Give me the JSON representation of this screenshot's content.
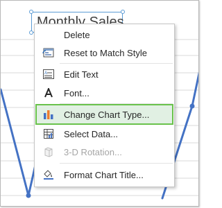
{
  "chart": {
    "title": "Monthly Sales",
    "line_color": "#4472c4"
  },
  "context_menu": {
    "items": [
      {
        "name": "delete",
        "icon": "delete-icon",
        "label": "Delete",
        "enabled": true
      },
      {
        "name": "reset-to-match-style",
        "icon": "reset-style-icon",
        "label": "Reset to Match Style",
        "enabled": true
      },
      {
        "name": "edit-text",
        "icon": "edit-text-icon",
        "label": "Edit Text",
        "enabled": true
      },
      {
        "name": "font",
        "icon": "font-icon",
        "label": "Font...",
        "enabled": true
      },
      {
        "name": "change-chart-type",
        "icon": "chart-type-icon",
        "label": "Change Chart Type...",
        "enabled": true,
        "highlighted": true
      },
      {
        "name": "select-data",
        "icon": "select-data-icon",
        "label": "Select Data...",
        "enabled": true
      },
      {
        "name": "3d-rotation",
        "icon": "3d-rotation-icon",
        "label": "3-D Rotation...",
        "enabled": false
      },
      {
        "name": "format-chart-title",
        "icon": "format-title-icon",
        "label": "Format Chart Title...",
        "enabled": true
      }
    ]
  },
  "colors": {
    "highlight_fill": "#e1f0e3",
    "highlight_border": "#69c24b",
    "selection": "#5b9bd5"
  }
}
